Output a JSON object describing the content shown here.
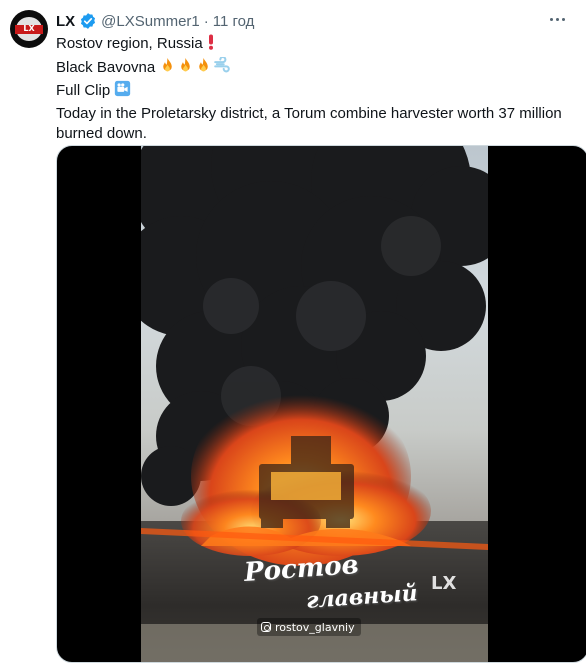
{
  "tweet": {
    "avatar_label": "LX",
    "author_name": "LX",
    "handle": "@LXSummer1",
    "separator": "·",
    "timestamp": "11 год",
    "lines": [
      {
        "text": "Rostov region, Russia ",
        "emojis": [
          "red-exclamation"
        ]
      },
      {
        "text": "Black Bavovna ",
        "emojis": [
          "fire",
          "fire",
          "fire",
          "dash"
        ]
      },
      {
        "text": "Full Clip ",
        "emojis": [
          "movie-camera"
        ]
      },
      {
        "text": "Today in the Proletarsky district, a Torum combine harvester worth 37 million burned down.",
        "emojis": []
      }
    ]
  },
  "media": {
    "watermark_line1": "Ростов",
    "watermark_line2": "главный",
    "watermark_mark": "LX",
    "source_handle": "rostov_glavniy"
  },
  "colors": {
    "verified": "#1d9bf0",
    "text_primary": "#0f1419",
    "text_secondary": "#536471",
    "border": "#cfd9de",
    "media_bg": "#000000"
  }
}
